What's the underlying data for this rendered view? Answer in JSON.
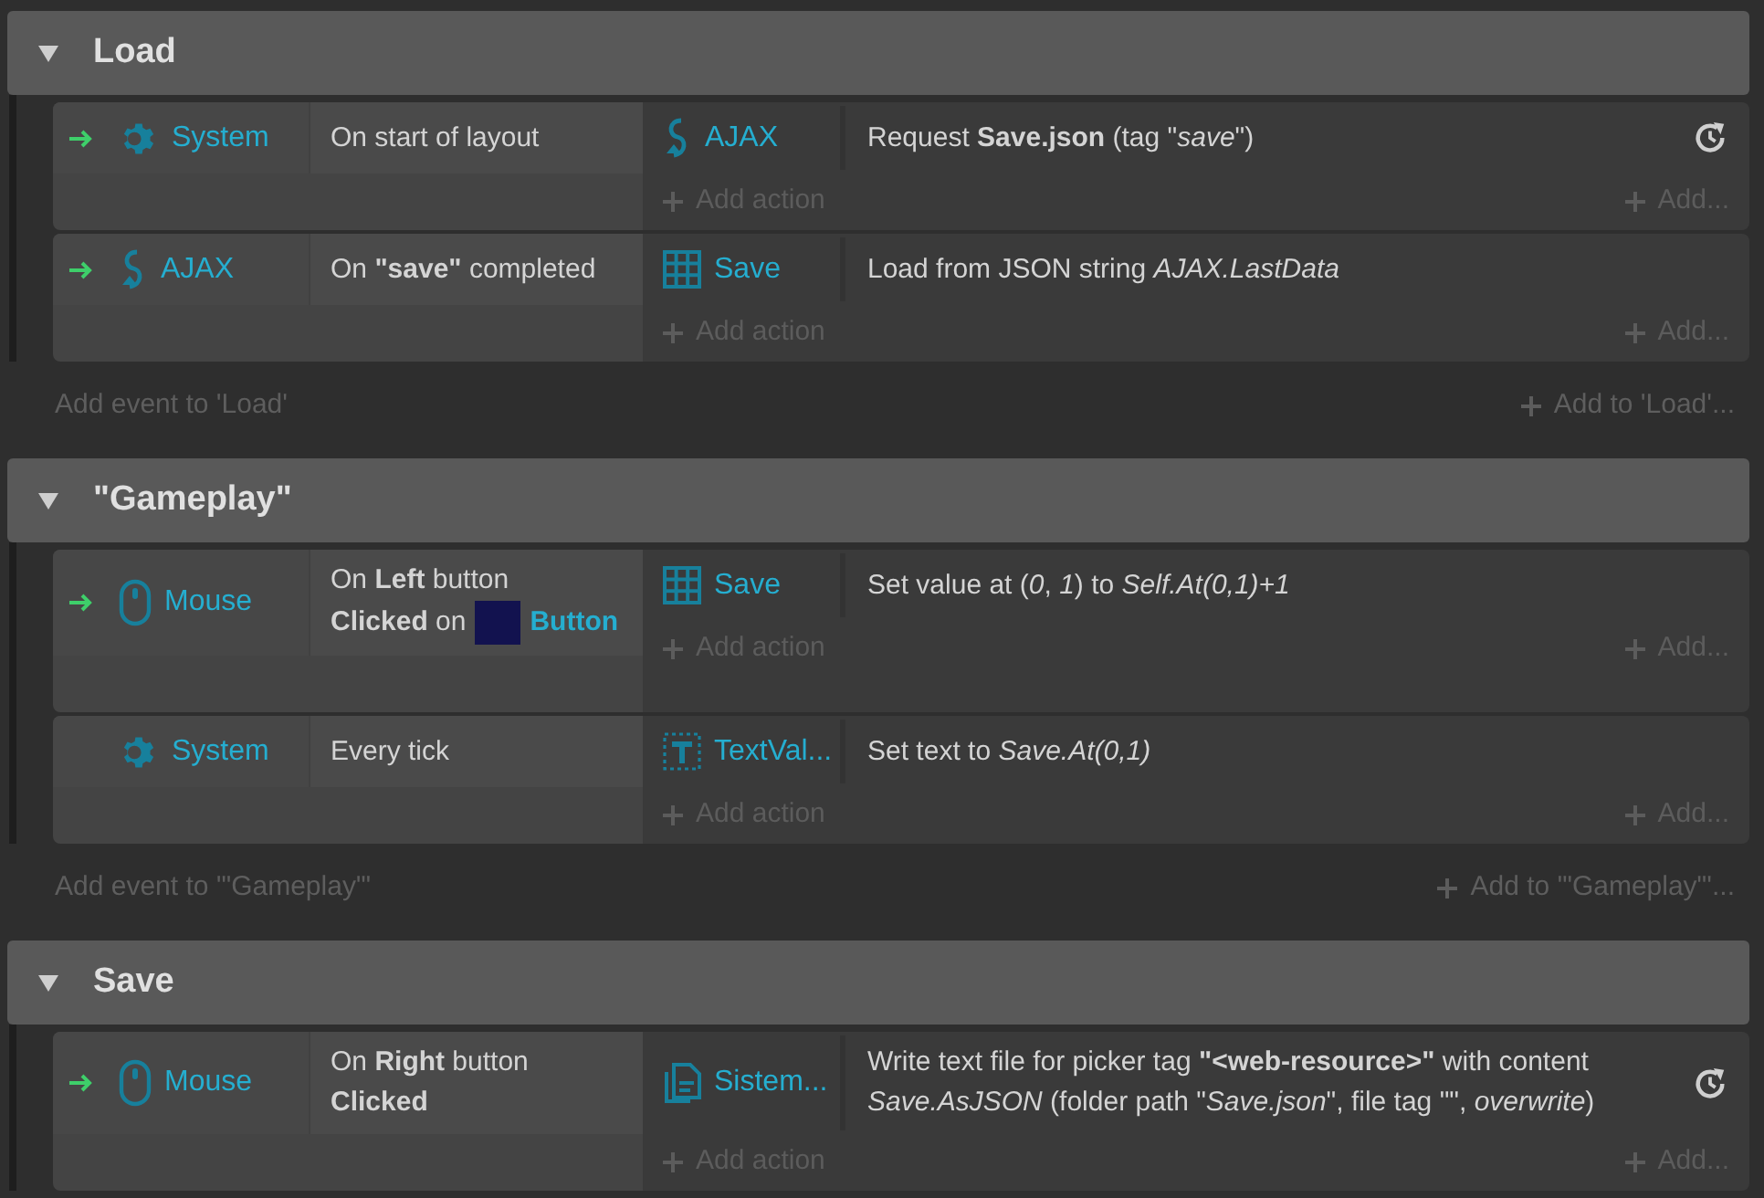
{
  "groups": [
    {
      "title": "Load",
      "expanded": true,
      "events": [
        {
          "conditions": [
            {
              "trigger": true,
              "object": {
                "name": "System",
                "kind": "gear"
              },
              "lines": [
                "On start of layout"
              ]
            }
          ],
          "actions": [
            {
              "object": {
                "name": "AJAX",
                "kind": "ajax"
              },
              "text": "Request **Save.json** (tag \"*save*\")",
              "async": true
            }
          ],
          "add_action": "Add action",
          "add": "Add..."
        },
        {
          "conditions": [
            {
              "trigger": true,
              "object": {
                "name": "AJAX",
                "kind": "ajax"
              },
              "lines": [
                "On **\"save\"** completed"
              ]
            }
          ],
          "actions": [
            {
              "object": {
                "name": "Save",
                "kind": "array"
              },
              "text": "Load from JSON string *AJAX.LastData*",
              "async": false
            }
          ],
          "add_action": "Add action",
          "add": "Add..."
        }
      ],
      "add_event": "Add event to 'Load'",
      "add_to": "Add to 'Load'..."
    },
    {
      "title": "\"Gameplay\"",
      "expanded": true,
      "events": [
        {
          "conditions": [
            {
              "trigger": true,
              "object": {
                "name": "Mouse",
                "kind": "mouse"
              },
              "lines": [
                "On **Left** button",
                "**Clicked** on"
              ],
              "ref": {
                "name": "Button"
              }
            }
          ],
          "actions": [
            {
              "object": {
                "name": "Save",
                "kind": "array"
              },
              "text": "Set value at (*0*, *1*) to *Self.At(0,1)+1*",
              "async": false
            }
          ],
          "add_action": "Add action",
          "add": "Add..."
        },
        {
          "conditions": [
            {
              "trigger": false,
              "object": {
                "name": "System",
                "kind": "gear"
              },
              "lines": [
                "Every tick"
              ]
            }
          ],
          "actions": [
            {
              "object": {
                "name": "TextVal...",
                "kind": "text"
              },
              "text": "Set text to *Save.At(0,1)*",
              "async": false
            }
          ],
          "add_action": "Add action",
          "add": "Add..."
        }
      ],
      "add_event": "Add event to '\"Gameplay\"'",
      "add_to": "Add to '\"Gameplay\"'..."
    },
    {
      "title": "Save",
      "expanded": true,
      "events": [
        {
          "conditions": [
            {
              "trigger": true,
              "object": {
                "name": "Mouse",
                "kind": "mouse"
              },
              "lines": [
                "On **Right** button",
                "**Clicked**"
              ]
            }
          ],
          "actions": [
            {
              "object": {
                "name": "Sistem...",
                "kind": "file"
              },
              "text": "Write text file for picker tag **\"<web-resource>\"** with content *Save.AsJSON* (folder path \"*Save.json*\", file tag \"\", *overwrite*)",
              "async": true
            }
          ],
          "add_action": "Add action",
          "add": "Add..."
        }
      ]
    }
  ]
}
